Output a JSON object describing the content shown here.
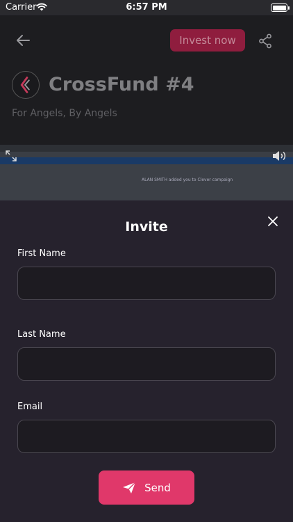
{
  "status_bar": {
    "carrier": "Carrier",
    "time": "6:57 PM"
  },
  "project": {
    "invest_label": "Invest now",
    "title": "CrossFund #4",
    "tagline": "For Angels, By Angels",
    "video_caption": "ALAN SMITH added you to Clever campaign"
  },
  "modal": {
    "title": "Invite",
    "fields": [
      {
        "label": "First Name",
        "value": "",
        "placeholder": ""
      },
      {
        "label": "Last Name",
        "value": "",
        "placeholder": ""
      },
      {
        "label": "Email",
        "value": "",
        "placeholder": ""
      }
    ],
    "send_label": "Send"
  },
  "colors": {
    "accent": "#e0386a",
    "invest_dimmed": "#8f1d3e",
    "modal_bg": "#26222d",
    "input_bg": "#1d1b21"
  },
  "icons": {
    "back": "arrow-left-icon",
    "share": "share-icon",
    "close": "close-icon",
    "send": "paper-plane-icon",
    "expand": "expand-icon",
    "volume": "volume-icon",
    "wifi": "wifi-icon",
    "battery": "battery-icon"
  }
}
